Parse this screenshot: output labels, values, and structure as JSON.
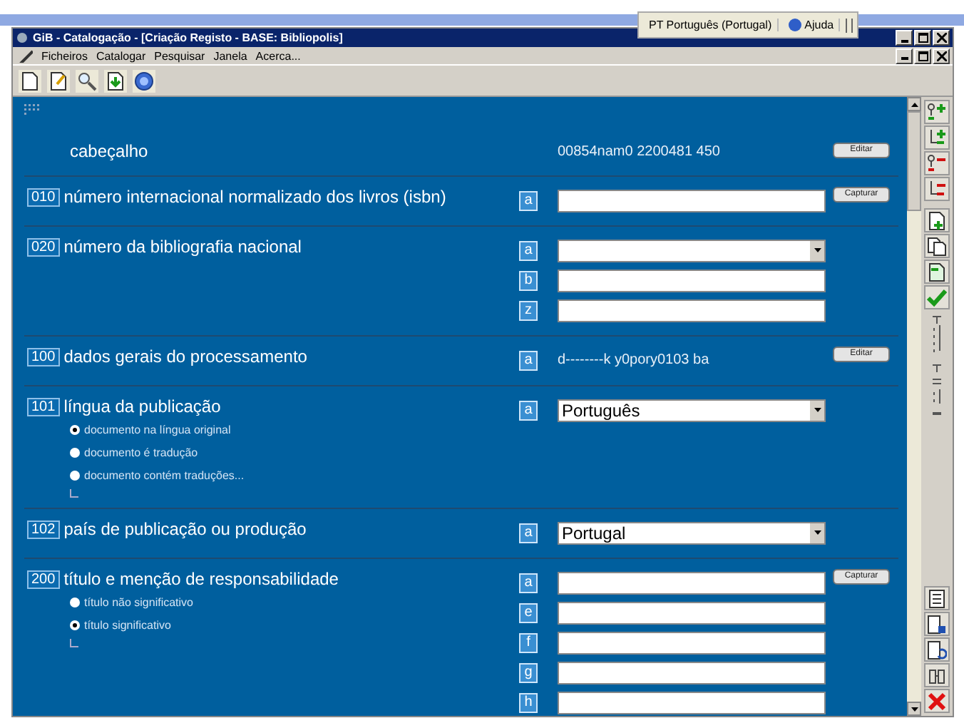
{
  "language_bar": {
    "language": "PT Português (Portugal)",
    "help": "Ajuda"
  },
  "window": {
    "title": "GiB - Catalogação - [Criação Registo - BASE: Bibliopolis]"
  },
  "menu": [
    "Ficheiros",
    "Catalogar",
    "Pesquisar",
    "Janela",
    "Acerca..."
  ],
  "header": {
    "label": "cabeçalho",
    "value": "00854nam0 2200481 450",
    "button": "Editar"
  },
  "fields": [
    {
      "tag": "010",
      "label": "número internacional normalizado dos livros (isbn)",
      "button": "Capturar",
      "subfields": [
        {
          "code": "a",
          "kind": "input"
        }
      ]
    },
    {
      "tag": "020",
      "label": "número da bibliografia nacional",
      "subfields": [
        {
          "code": "a",
          "kind": "select"
        },
        {
          "code": "b",
          "kind": "input"
        },
        {
          "code": "z",
          "kind": "input"
        }
      ]
    },
    {
      "tag": "100",
      "label": "dados gerais do processamento",
      "button": "Editar",
      "subfields": [
        {
          "code": "a",
          "kind": "text",
          "value": "d--------k y0pory0103 ba"
        }
      ]
    },
    {
      "tag": "101",
      "label": "língua da publicação",
      "options": [
        {
          "label": "documento na língua original",
          "selected": true
        },
        {
          "label": "documento é tradução",
          "selected": false
        },
        {
          "label": "documento contém traduções...",
          "selected": false
        }
      ],
      "subfields": [
        {
          "code": "a",
          "kind": "select",
          "value": "Português"
        }
      ]
    },
    {
      "tag": "102",
      "label": "país de publicação ou produção",
      "subfields": [
        {
          "code": "a",
          "kind": "select",
          "value": "Portugal"
        }
      ]
    },
    {
      "tag": "200",
      "label": "título e menção de responsabilidade",
      "button": "Capturar",
      "options": [
        {
          "label": "título não significativo",
          "selected": false
        },
        {
          "label": "título significativo",
          "selected": true
        }
      ],
      "subfields": [
        {
          "code": "a",
          "kind": "input"
        },
        {
          "code": "e",
          "kind": "input"
        },
        {
          "code": "f",
          "kind": "input"
        },
        {
          "code": "g",
          "kind": "input"
        },
        {
          "code": "h",
          "kind": "input"
        }
      ]
    }
  ]
}
